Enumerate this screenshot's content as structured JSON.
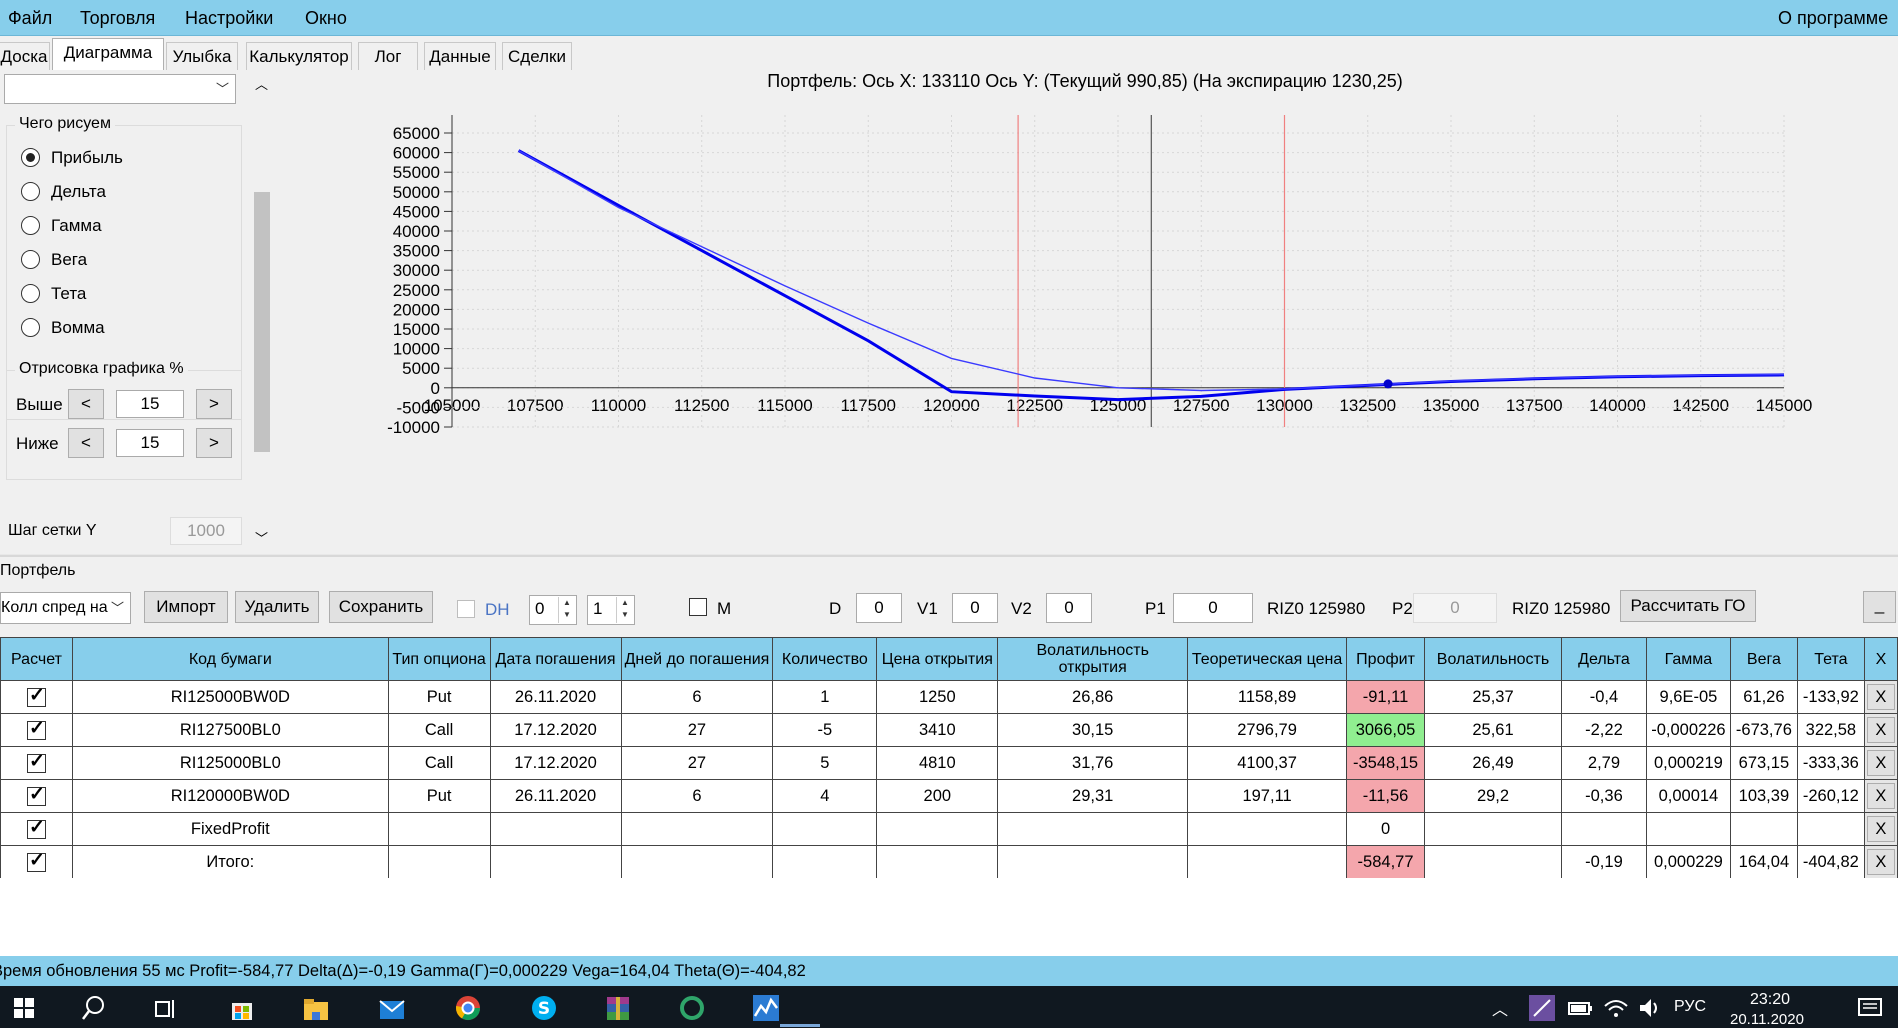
{
  "menu": {
    "items": [
      "Файл",
      "Торговля",
      "Настройки",
      "Окно"
    ],
    "about": "О программе"
  },
  "tabs": [
    "Доска",
    "Диаграмма",
    "Улыбка",
    "Калькулятор",
    "Лог",
    "Данные",
    "Сделки"
  ],
  "active_tab": "Диаграмма",
  "left": {
    "group_draw": "Чего рисуем",
    "radios": [
      "Прибыль",
      "Дельта",
      "Гамма",
      "Вега",
      "Тета",
      "Вомма"
    ],
    "selected_radio": "Прибыль",
    "group_render": "Отрисовка графика %",
    "above_label": "Выше",
    "above_value": "15",
    "below_label": "Ниже",
    "below_value": "15",
    "prev_glyph": "<",
    "next_glyph": ">",
    "grid_step_label": "Шаг сетки Y",
    "grid_step_value": "1000"
  },
  "chart_data": {
    "type": "line",
    "title": "Портфель: Ось X: 133110 Ось Y:  (Текущий 990,85)  (На экспирацию 1230,25)",
    "xlim": [
      105000,
      145000
    ],
    "ylim": [
      -10000,
      65000
    ],
    "x_ticks": [
      "105000",
      "107500",
      "110000",
      "112500",
      "115000",
      "117500",
      "120000",
      "122500",
      "125000",
      "127500",
      "130000",
      "132500",
      "135000",
      "137500",
      "140000",
      "142500",
      "145000"
    ],
    "y_ticks": [
      "65000",
      "60000",
      "55000",
      "50000",
      "45000",
      "40000",
      "35000",
      "30000",
      "25000",
      "20000",
      "15000",
      "10000",
      "5000",
      "0",
      "-5000",
      "-10000"
    ],
    "vertical_markers": [
      {
        "x": 122000,
        "color": "#f08080"
      },
      {
        "x": 126000,
        "color": "#555555"
      },
      {
        "x": 130000,
        "color": "#f08080"
      }
    ],
    "current_point": {
      "x": 133110,
      "y": 990.85
    },
    "series": [
      {
        "role": "expiration",
        "color": "#0000ee",
        "x": [
          107000,
          110000,
          112500,
          115000,
          117500,
          120000,
          122500,
          125000,
          127500,
          130000,
          132500,
          135000,
          137500,
          140000,
          142500,
          145000
        ],
        "y": [
          60500,
          46500,
          35000,
          23500,
          12000,
          -1000,
          -2100,
          -3000,
          -2200,
          -400,
          600,
          1600,
          2300,
          2800,
          3100,
          3300
        ]
      },
      {
        "role": "current",
        "color": "#3a3aff",
        "x": [
          107000,
          110000,
          112500,
          115000,
          117500,
          120000,
          122500,
          125000,
          127500,
          130000,
          132500,
          135000,
          137500,
          140000,
          142500,
          145000
        ],
        "y": [
          60500,
          46000,
          36000,
          26000,
          16500,
          7500,
          2500,
          0,
          -700,
          -300,
          700,
          1700,
          2400,
          2900,
          3200,
          3400
        ]
      }
    ]
  },
  "portfolio": {
    "label": "Портфель",
    "strategy": "Колл спред на",
    "buttons": {
      "import": "Импорт",
      "delete": "Удалить",
      "save": "Сохранить",
      "calc_go": "Рассчитать ГО",
      "minimize": "_"
    },
    "dh_label": "DH",
    "spin1": "0",
    "spin2": "1",
    "m_label": "M",
    "d_label": "D",
    "d_value": "0",
    "v1_label": "V1",
    "v1_value": "0",
    "v2_label": "V2",
    "v2_value": "0",
    "p1_label": "P1",
    "p1_value": "0",
    "p1_code": "RIZ0 125980",
    "p2_label": "P2",
    "p2_value": "0",
    "p2_code": "RIZ0 125980"
  },
  "table": {
    "headers": [
      "Расчет",
      "Код бумаги",
      "Тип опциона",
      "Дата погашения",
      "Дней до погашения",
      "Количество",
      "Цена открытия",
      "Волатильность открытия",
      "Теоретическая цена",
      "Профит",
      "Волатильность",
      "Дельта",
      "Гамма",
      "Вега",
      "Тета",
      "X"
    ],
    "rows": [
      [
        "RI125000BW0D",
        "Put",
        "26.11.2020",
        "6",
        "1",
        "1250",
        "26,86",
        "1158,89",
        "-91,11",
        "25,37",
        "-0,4",
        "9,6E-05",
        "61,26",
        "-133,92"
      ],
      [
        "RI127500BL0",
        "Call",
        "17.12.2020",
        "27",
        "-5",
        "3410",
        "30,15",
        "2796,79",
        "3066,05",
        "25,61",
        "-2,22",
        "-0,000226",
        "-673,76",
        "322,58"
      ],
      [
        "RI125000BL0",
        "Call",
        "17.12.2020",
        "27",
        "5",
        "4810",
        "31,76",
        "4100,37",
        "-3548,15",
        "26,49",
        "2,79",
        "0,000219",
        "673,15",
        "-333,36"
      ],
      [
        "RI120000BW0D",
        "Put",
        "26.11.2020",
        "6",
        "4",
        "200",
        "29,31",
        "197,11",
        "-11,56",
        "29,2",
        "-0,36",
        "0,00014",
        "103,39",
        "-260,12"
      ],
      [
        "FixedProfit",
        "",
        "",
        "",
        "",
        "",
        "",
        "",
        "0",
        "",
        "",
        "",
        "",
        ""
      ],
      [
        "Итого:",
        "",
        "",
        "",
        "",
        "",
        "",
        "",
        "-584,77",
        "",
        "-0,19",
        "0,000229",
        "164,04",
        "-404,82"
      ]
    ],
    "profit_colors": [
      "neg",
      "pos",
      "neg",
      "neg",
      "",
      "neg"
    ],
    "x_label": "X"
  },
  "status": "Время обновления 55 мс  Profit=-584,77 Delta(Δ)=-0,19 Gamma(Γ)=0,000229 Vega=164,04 Theta(Θ)=-404,82",
  "taskbar": {
    "lang": "РУС",
    "time": "23:20",
    "date": "20.11.2020"
  }
}
